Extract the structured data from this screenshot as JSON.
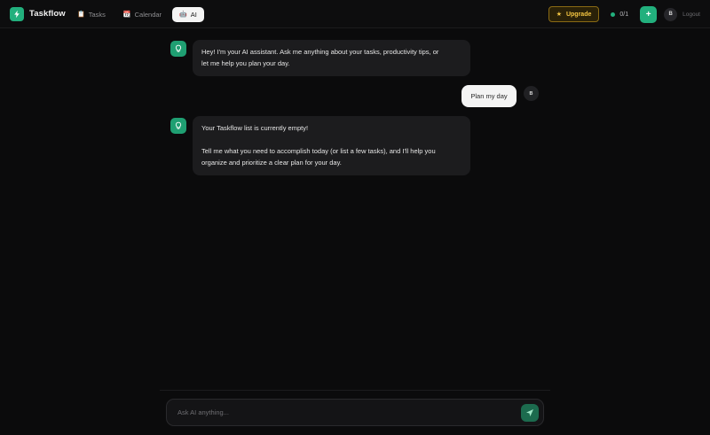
{
  "app": {
    "name": "Taskflow"
  },
  "nav": {
    "tabs": [
      {
        "label": "Tasks",
        "icon": "clipboard-icon",
        "glyph": "📋"
      },
      {
        "label": "Calendar",
        "icon": "calendar-icon",
        "glyph": "📆"
      },
      {
        "label": "AI",
        "icon": "robot-icon",
        "glyph": "🤖",
        "active": true
      }
    ]
  },
  "header": {
    "upgrade_label": "Upgrade",
    "progress_text": "0/1",
    "add_label": "+",
    "user_initial": "B",
    "logout_label": "Logout"
  },
  "chat": {
    "messages": [
      {
        "role": "assistant",
        "lines": [
          "Hey! I'm your AI assistant. Ask me anything about your tasks, productivity tips, or",
          "let me help you plan your day."
        ]
      },
      {
        "role": "user",
        "text": "Plan my day",
        "initial": "B"
      },
      {
        "role": "assistant",
        "lines": [
          "Your Taskflow list is currently empty!",
          "",
          "Tell me what you need to accomplish today (or list a few tasks), and I'll help you",
          "organize and prioritize a clear plan for your day."
        ]
      }
    ]
  },
  "composer": {
    "placeholder": "Ask AI anything...",
    "value": ""
  },
  "colors": {
    "accent": "#22b07d",
    "upgrade": "#f4c542",
    "background": "#0b0b0c"
  }
}
